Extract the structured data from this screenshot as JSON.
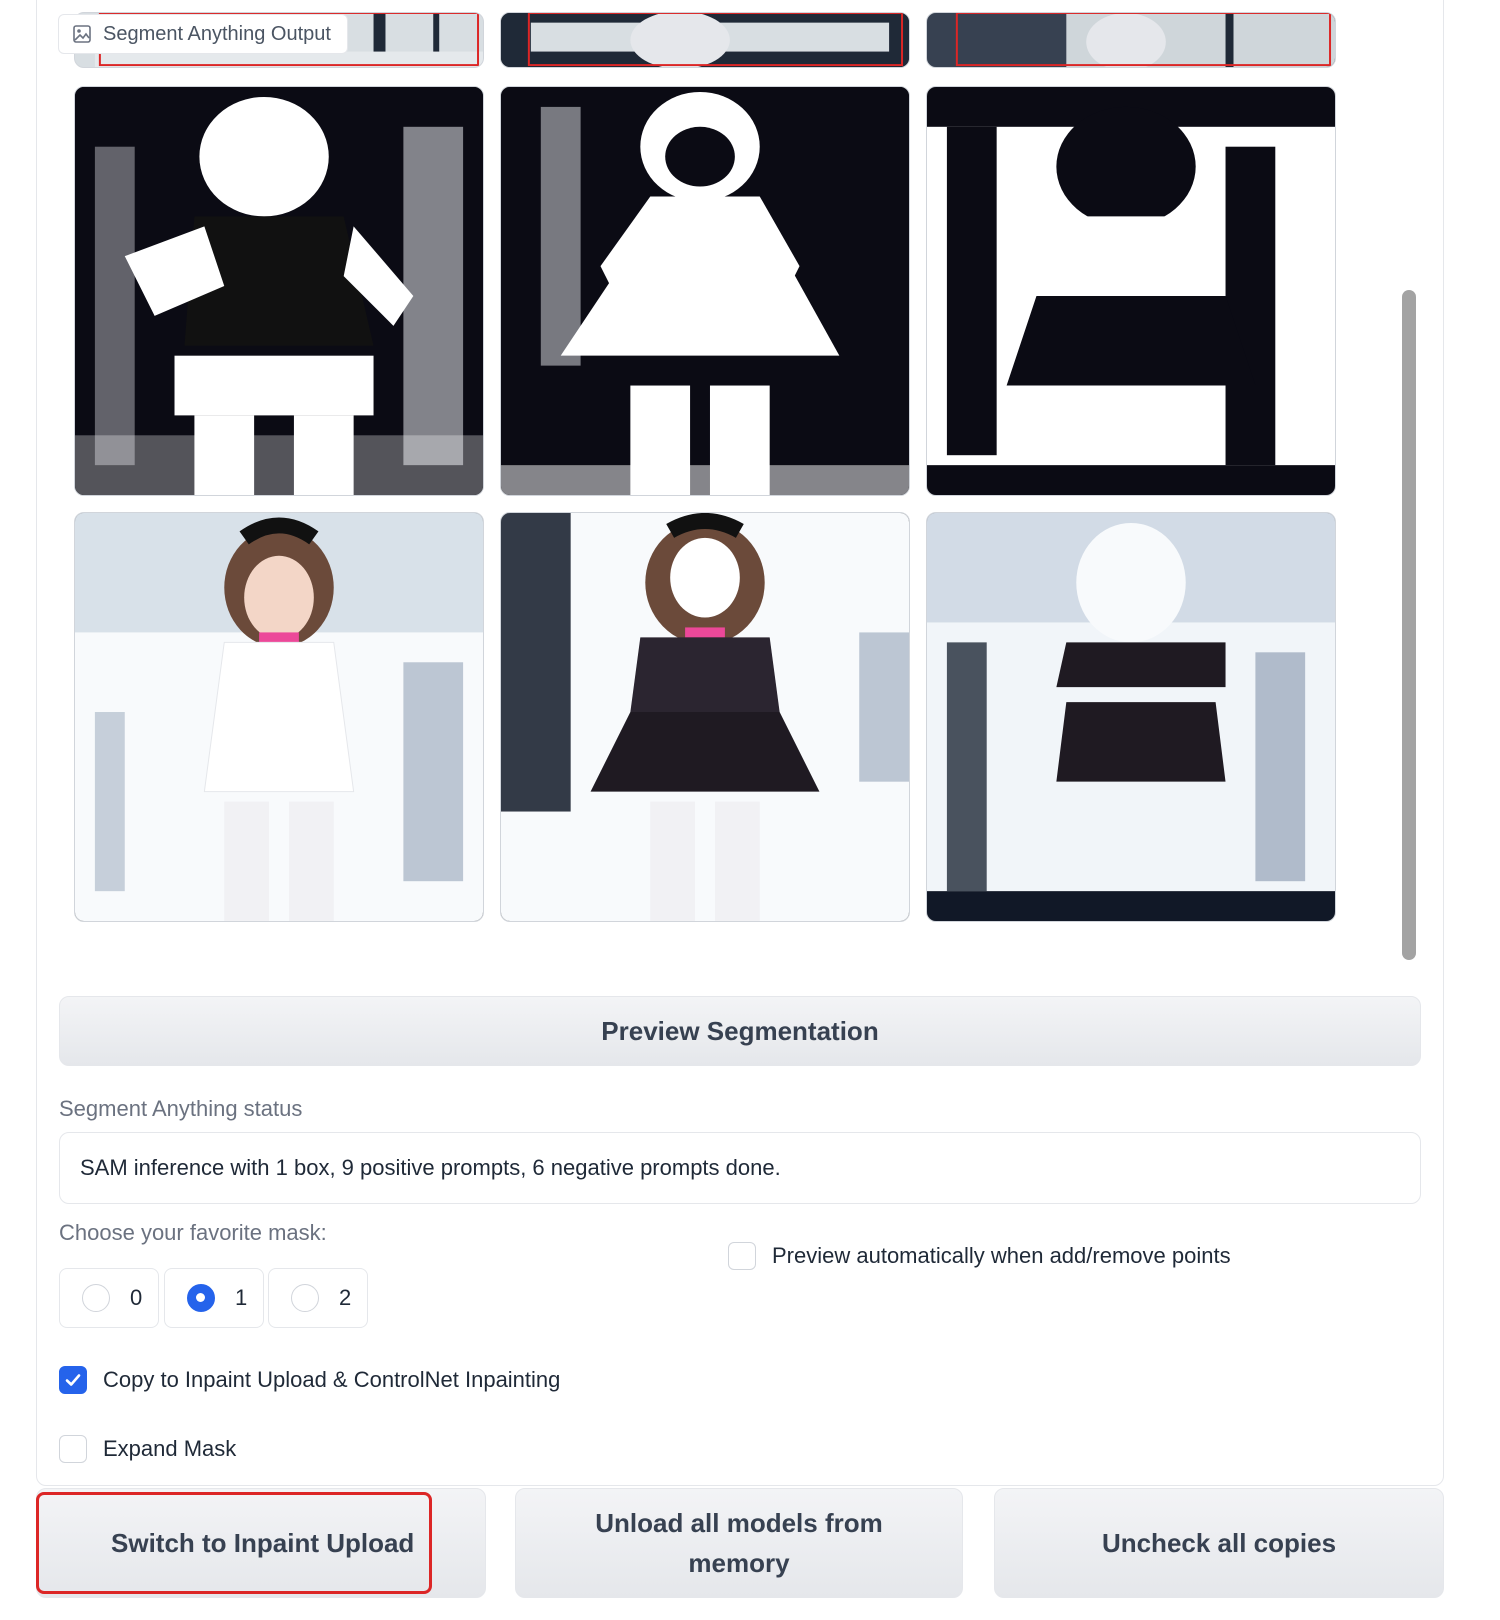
{
  "gallery": {
    "label": "Segment Anything Output",
    "icon": "image-icon"
  },
  "preview_button": {
    "label": "Preview Segmentation"
  },
  "status": {
    "label": "Segment Anything status",
    "value": "SAM inference with 1 box, 9 positive prompts, 6 negative prompts done."
  },
  "mask_choice": {
    "label": "Choose your favorite mask:",
    "options": [
      "0",
      "1",
      "2"
    ],
    "selected": "1"
  },
  "auto_preview": {
    "label": "Preview automatically when add/remove points",
    "checked": false
  },
  "copy_inpaint": {
    "label": "Copy to Inpaint Upload & ControlNet Inpainting",
    "checked": true
  },
  "expand_mask": {
    "label": "Expand Mask",
    "checked": false
  },
  "actions": {
    "switch_label": "Switch to Inpaint Upload",
    "unload_label": "Unload all models from memory",
    "uncheck_label": "Uncheck all copies"
  },
  "colors": {
    "accent": "#2563eb",
    "highlight": "#dc2626"
  }
}
